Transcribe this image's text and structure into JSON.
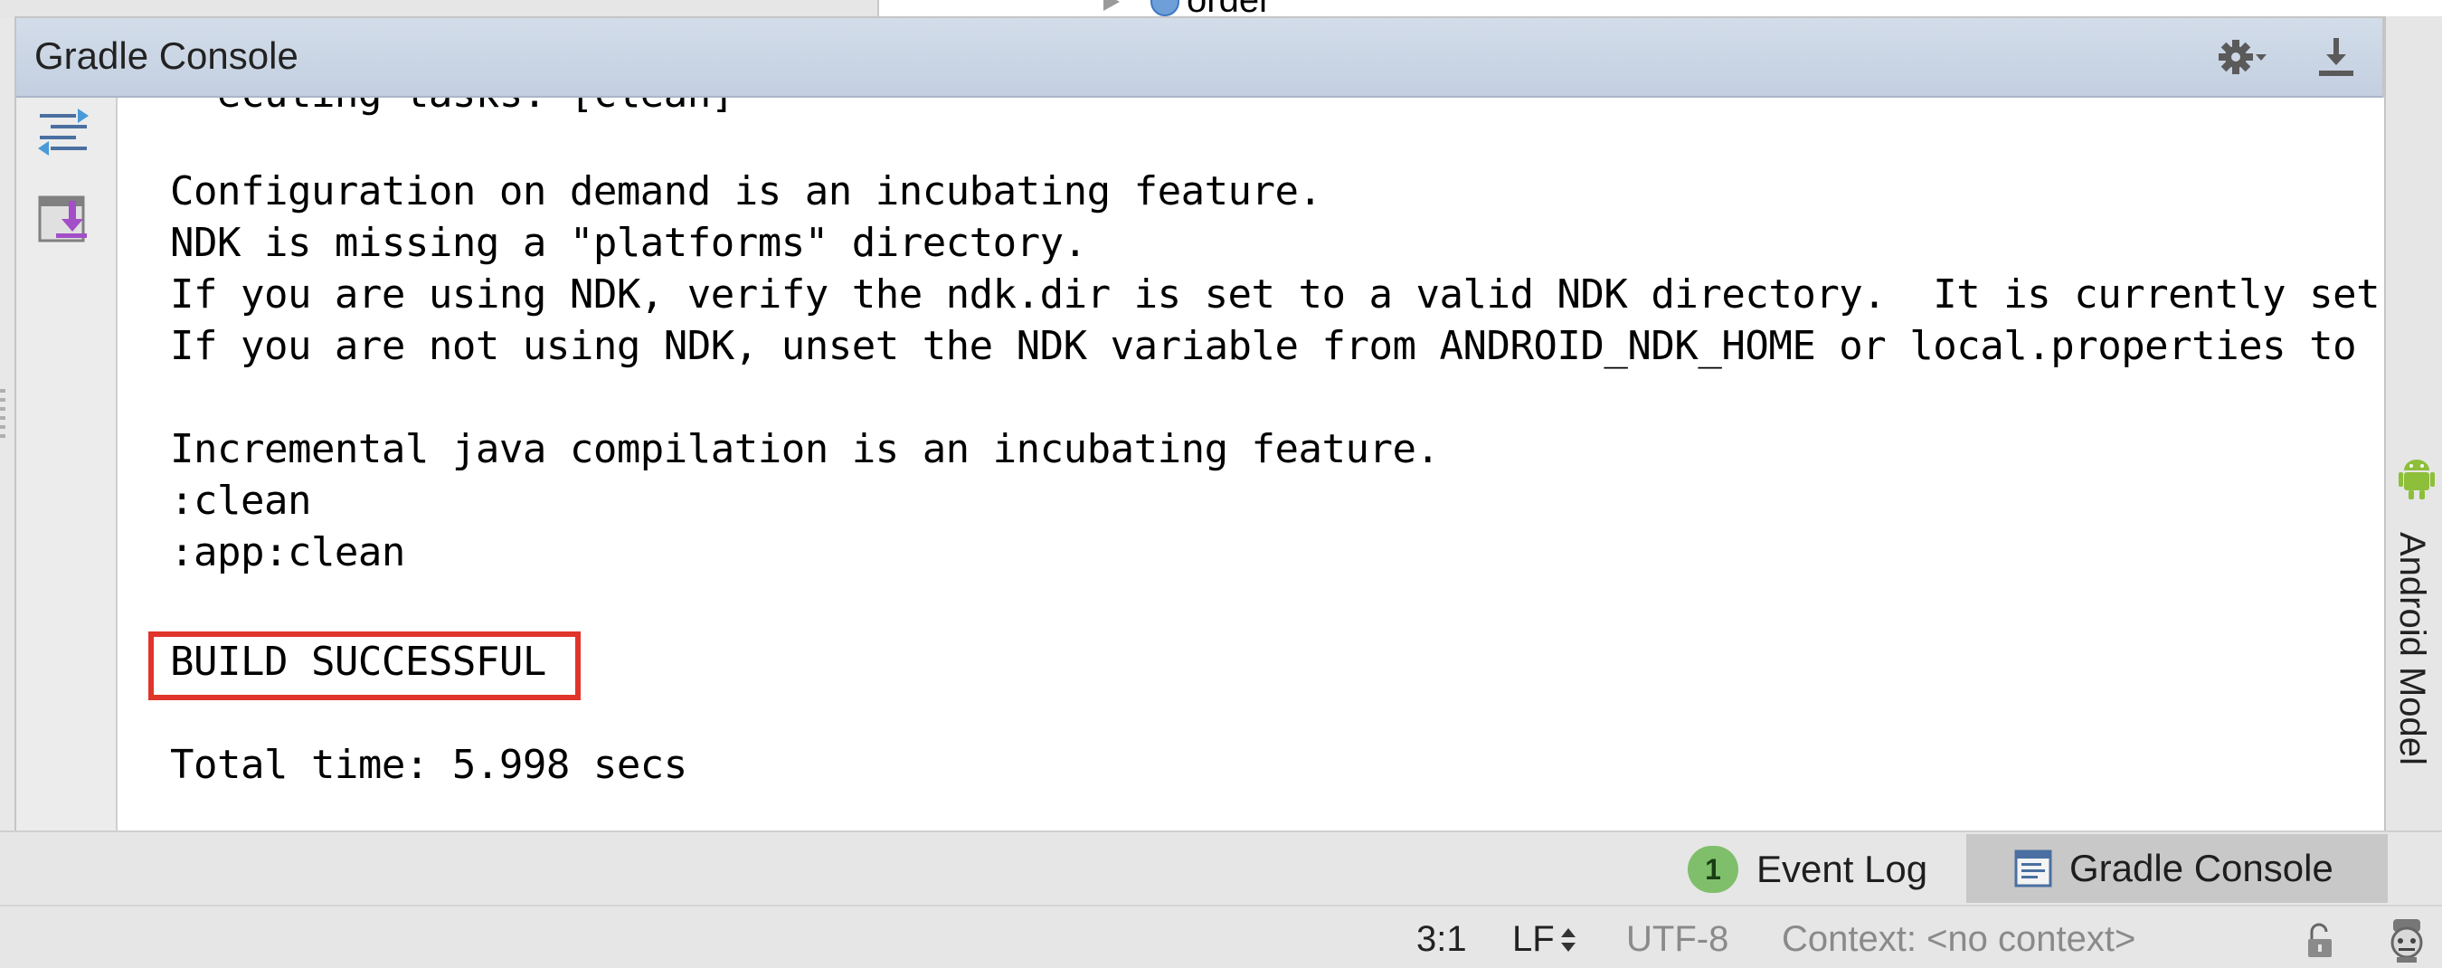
{
  "project_tree": {
    "partial_label": "order"
  },
  "panel": {
    "title": "Gradle Console",
    "settings_icon": "gear-dropdown-icon",
    "hide_icon": "hide-down-icon"
  },
  "gutter": {
    "toggle_icon": "toggle-view-icon",
    "scroll_icon": "scroll-to-end-icon"
  },
  "console": {
    "cut_off_line": "  ecuting tasks: [clean]",
    "lines": [
      "Configuration on demand is an incubating feature.",
      "NDK is missing a \"platforms\" directory.",
      "If you are using NDK, verify the ndk.dir is set to a valid NDK directory.  It is currently set to",
      "If you are not using NDK, unset the NDK variable from ANDROID_NDK_HOME or local.properties to",
      "",
      "Incremental java compilation is an incubating feature.",
      ":clean",
      ":app:clean",
      "",
      "BUILD SUCCESSFUL",
      "",
      "Total time: 5.998 secs"
    ],
    "highlight_color": "#e0352b"
  },
  "right_strip": {
    "label": "Android Model",
    "icon": "android-icon"
  },
  "tool_windows": {
    "event_log": {
      "badge": "1",
      "label": "Event Log"
    },
    "gradle_console": {
      "label": "Gradle Console",
      "icon": "console-icon"
    }
  },
  "statusbar": {
    "position": "3:1",
    "line_separator": "LF",
    "encoding": "UTF-8",
    "context": "Context: <no context>",
    "lock_icon": "unlock-icon",
    "inspector_icon": "inspector-icon"
  }
}
